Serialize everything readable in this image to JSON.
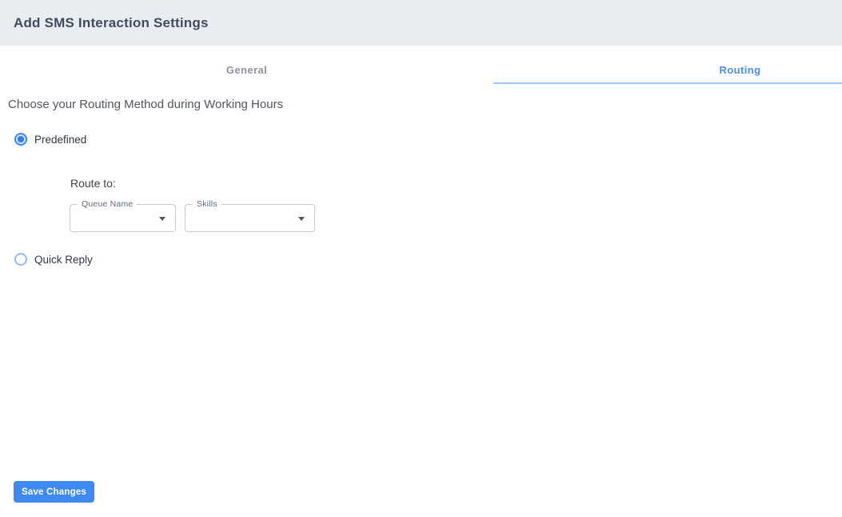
{
  "header": {
    "title": "Add SMS Interaction Settings"
  },
  "tabs": [
    {
      "label": "General",
      "active": false
    },
    {
      "label": "Routing",
      "active": true
    }
  ],
  "routing": {
    "question": "Choose your Routing Method during Working Hours",
    "options": [
      {
        "label": "Predefined",
        "selected": true
      },
      {
        "label": "Quick Reply",
        "selected": false
      }
    ],
    "route_to_label": "Route to:",
    "dropdowns": [
      {
        "label": "Queue Name",
        "value": ""
      },
      {
        "label": "Skills",
        "value": ""
      }
    ]
  },
  "actions": {
    "save_label": "Save Changes"
  },
  "icons": {
    "dropdown_caret": "caret-down",
    "radio_selected": "radio-filled",
    "radio_unselected": "radio-empty"
  },
  "colors": {
    "header_bg": "#e9edf2",
    "title_text": "#3f4c5d",
    "tab_inactive": "#8d939e",
    "tab_active": "#4a8df5",
    "tab_indicator": "#9fc4f8",
    "radio_blue": "#2e7cf0",
    "field_border": "#c5cbd4",
    "button_bg": "#3f8af2"
  }
}
